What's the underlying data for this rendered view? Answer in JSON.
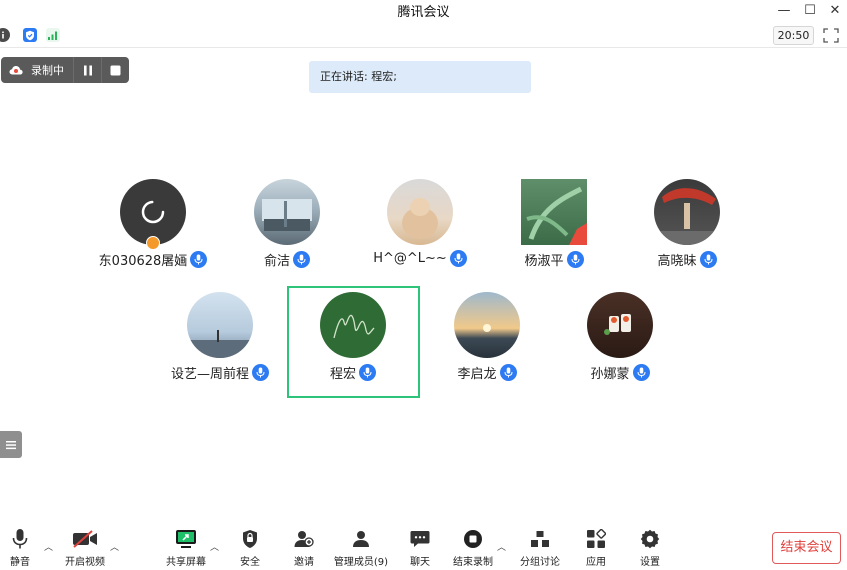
{
  "window": {
    "title": "腾讯会议",
    "minimize": "—",
    "maximize": "☐",
    "close": "✕"
  },
  "statusbar": {
    "clock": "20:50"
  },
  "recording": {
    "label": "录制中"
  },
  "speaking": {
    "text": "正在讲话: 程宏;"
  },
  "participants": [
    {
      "name": "东030628屠婳",
      "avatar": "loading"
    },
    {
      "name": "俞洁",
      "avatar": "photo-room"
    },
    {
      "name": "H^@^L~~",
      "avatar": "photo-cat"
    },
    {
      "name": "杨淑平",
      "avatar": "photo-plant"
    },
    {
      "name": "高晓昧",
      "avatar": "photo-dancer"
    },
    {
      "name": "设艺—周前程",
      "avatar": "photo-sea"
    },
    {
      "name": "程宏",
      "avatar": "green-signature"
    },
    {
      "name": "李启龙",
      "avatar": "photo-sunset"
    },
    {
      "name": "孙娜蒙",
      "avatar": "photo-food"
    }
  ],
  "toolbar": {
    "mute": "静音",
    "video": "开启视频",
    "share": "共享屏幕",
    "security": "安全",
    "invite": "邀请",
    "members": "管理成员(9)",
    "chat": "聊天",
    "stop_record": "结束录制",
    "breakout": "分组讨论",
    "apps": "应用",
    "settings": "设置",
    "end": "结束会议"
  },
  "colors": {
    "accent": "#2d7bf3",
    "selected_border": "#2dc47a",
    "end_red": "#e0403c",
    "speaking_bg": "#dceaf9"
  }
}
